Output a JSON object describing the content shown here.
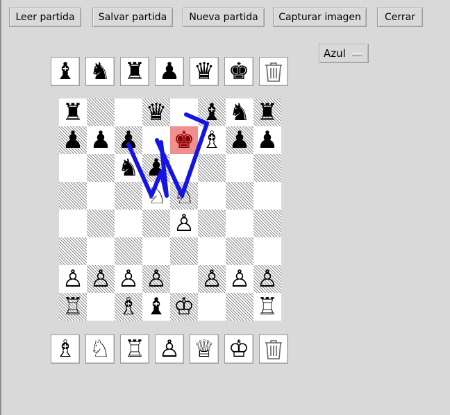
{
  "toolbar": {
    "load_label": "Leer partida",
    "save_label": "Salvar partida",
    "new_label": "Nueva partida",
    "capture_label": "Capturar imagen",
    "close_label": "Cerrar"
  },
  "color_select": {
    "value": "Azul"
  },
  "black_tray": [
    "♝",
    "♞",
    "♜",
    "♟",
    "♛",
    "♚"
  ],
  "white_tray": [
    "♗",
    "♘",
    "♖",
    "♙",
    "♕",
    "♔"
  ],
  "board": [
    [
      "♜",
      "",
      "",
      "♛",
      "",
      "♝",
      "♞",
      "♜"
    ],
    [
      "♟",
      "♟",
      "♟",
      "",
      "♚",
      "♗",
      "♟",
      "♟"
    ],
    [
      "",
      "",
      "♞",
      "♟",
      "",
      "",
      "",
      ""
    ],
    [
      "",
      "",
      "",
      "♘",
      "♘",
      "",
      "",
      ""
    ],
    [
      "",
      "",
      "",
      "",
      "♙",
      "",
      "",
      ""
    ],
    [
      "",
      "",
      "",
      "",
      "",
      "",
      "",
      ""
    ],
    [
      "♙",
      "♙",
      "♙",
      "♙",
      "",
      "♙",
      "♙",
      "♙"
    ],
    [
      "♖",
      "",
      "♗",
      "♝",
      "♔",
      "",
      "",
      "♖"
    ]
  ],
  "highlight": {
    "row": 1,
    "col": 4,
    "color": "#ef8f8f"
  },
  "annotation_color": "#1414e6"
}
